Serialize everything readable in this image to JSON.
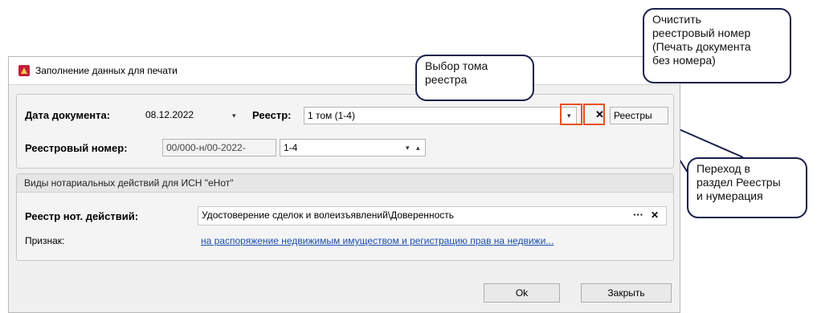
{
  "window": {
    "title": "Заполнение данных для печати"
  },
  "form": {
    "date_label": "Дата документа:",
    "date_value": "08.12.2022",
    "registry_label": "Реестр:",
    "registry_value": "1 том (1-4)",
    "registries_button": "Реестры",
    "regnum_label": "Реестровый номер:",
    "regnum_prefix": "00/000-н/00-2022-",
    "regnum_range": "1-4"
  },
  "section2": {
    "header": "Виды нотариальных действий для ИСН \"еНот\"",
    "action_label": "Реестр нот. действий:",
    "action_value": "Удостоверение сделок и волеизъявлений\\Доверенность",
    "sign_label": "Признак:",
    "sign_link": "на распоряжение недвижимым имуществом и регистрацию прав на недвижи..."
  },
  "buttons": {
    "ok": "Ok",
    "close": "Закрыть"
  },
  "callouts": {
    "volume": "Выбор тома\nреестра",
    "clear": "Очистить\nреестровый номер\n(Печать документа\nбез номера)",
    "goto": "Переход в\nраздел Реестры\nи нумерация"
  },
  "icons": {
    "dropdown": "▾",
    "clear": "✕",
    "ellipsis": "···",
    "spin_up": "▴"
  },
  "colors": {
    "highlight": "#e8501d",
    "callout_border": "#1a1f4a",
    "link": "#1b4fae"
  }
}
